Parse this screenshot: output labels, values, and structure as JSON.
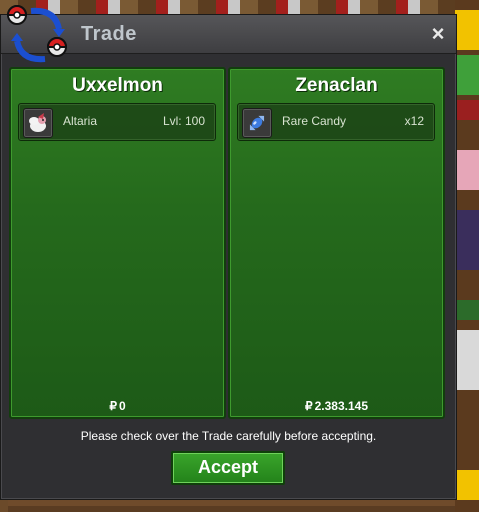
{
  "window": {
    "title": "Trade",
    "close_glyph": "×"
  },
  "trade": {
    "left": {
      "player": "Uxxelmon",
      "item": {
        "icon": "pokemon-icon",
        "name": "Altaria",
        "extra": "Lvl: 100"
      },
      "money": "0"
    },
    "right": {
      "player": "Zenaclan",
      "item": {
        "icon": "rare-candy-icon",
        "name": "Rare Candy",
        "extra": "x12"
      },
      "money": "2.383.145"
    },
    "currency_glyph": "₽"
  },
  "footer": {
    "notice": "Please check over the Trade carefully before accepting.",
    "accept_label": "Accept"
  },
  "colors": {
    "panel_green": "#2f7c22",
    "accept_green": "#3aa52b",
    "window_bg": "#2f2f32"
  }
}
